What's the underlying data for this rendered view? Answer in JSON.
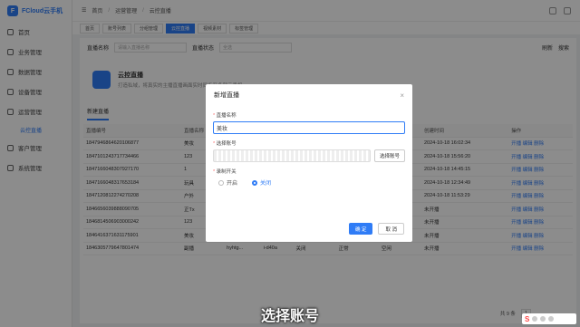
{
  "brand": {
    "name": "FCloud云手机",
    "logo": "F"
  },
  "sidebar": {
    "items": [
      {
        "label": "首页",
        "icon": "home-icon"
      },
      {
        "label": "业务管理",
        "icon": "briefcase-icon"
      },
      {
        "label": "数据管理",
        "icon": "database-icon"
      },
      {
        "label": "设备管理",
        "icon": "device-icon"
      },
      {
        "label": "运营管理",
        "icon": "operation-icon"
      }
    ],
    "sub": "云控直播",
    "items2": [
      {
        "label": "客户管理",
        "icon": "user-icon"
      },
      {
        "label": "系统管理",
        "icon": "settings-icon"
      }
    ]
  },
  "breadcrumb": [
    "首页",
    "运营管理",
    "云控直播"
  ],
  "tabs": [
    "首页",
    "账号列表",
    "分组管理",
    "云控直播",
    "视频素材",
    "标签管理"
  ],
  "filter": {
    "name_label": "直播名称",
    "name_placeholder": "请输入直播名称",
    "status_label": "直播状态",
    "status_value": "全选",
    "refresh": "刷新",
    "search": "搜索"
  },
  "live": {
    "title": "云控直播",
    "desc": "打造私域，将真实的主播直播画面实时同步至多部云手机..."
  },
  "new_live_btn": "新建直播",
  "table": {
    "headers": [
      "直播编号",
      "直播名称",
      "账号",
      "平台",
      "直播状态",
      "推流状态",
      "在线状态",
      "创建时间",
      "操作"
    ],
    "rows": [
      [
        "1847946864620106877",
        "美妆",
        "",
        "",
        "",
        "",
        "在线",
        "2024-10-18 16:02:34",
        "开播 编辑 删除"
      ],
      [
        "1847101243717734466",
        "123",
        "",
        "",
        "",
        "",
        "在线",
        "2024-10-18 15:56:20",
        "开播 编辑 删除"
      ],
      [
        "1847166048307927170",
        "1",
        "",
        "",
        "",
        "",
        "在线",
        "2024-10-18 14:45:15",
        "开播 编辑 删除"
      ],
      [
        "1847166048317653184",
        "玩具",
        "",
        "",
        "",
        "",
        "在线",
        "2024-10-18 12:34:49",
        "开播 编辑 删除"
      ],
      [
        "1847120812274270208",
        "户外",
        "",
        "",
        "",
        "",
        "在线",
        "2024-10-18 11:53:29",
        "开播 编辑 删除"
      ],
      [
        "1846656039888090705",
        "正Tx",
        "hyhtg...",
        "i-d40a",
        "开播",
        "正常",
        "空闲",
        "未开播",
        "开播 编辑 删除"
      ],
      [
        "1846814506903000242",
        "123",
        "hyhtg...",
        "i-d40a",
        "开播",
        "正常",
        "空闲",
        "未开播",
        "开播 编辑 删除"
      ],
      [
        "1846416371631175901",
        "美妆",
        "hyhtg...",
        "i-d40a",
        "开播",
        "正常",
        "空闲",
        "未开播",
        "开播 编辑 删除"
      ],
      [
        "1846305779647801474",
        "副播",
        "hyhtg...",
        "i-d40a",
        "关闭",
        "正常",
        "空闲",
        "未开播",
        "开播 编辑 删除"
      ]
    ],
    "times_extra": [
      "2024-10-17 11:00:27",
      "2024-10-15 16:54:59",
      "2024-10-15 12:29:26",
      "2024-10-12 13:51:09"
    ]
  },
  "pager": {
    "total": "共 9 条",
    "page": "1"
  },
  "modal": {
    "title": "新增直播",
    "close": "×",
    "name_label": "直播名称",
    "name_value": "美妆",
    "account_label": "选择账号",
    "select_btn": "选择账号",
    "auto_label": "录制开关",
    "on": "开启",
    "off": "关闭",
    "confirm": "确 定",
    "cancel": "取 消"
  },
  "subtitle": "选择账号",
  "ime": {
    "label": "S"
  }
}
